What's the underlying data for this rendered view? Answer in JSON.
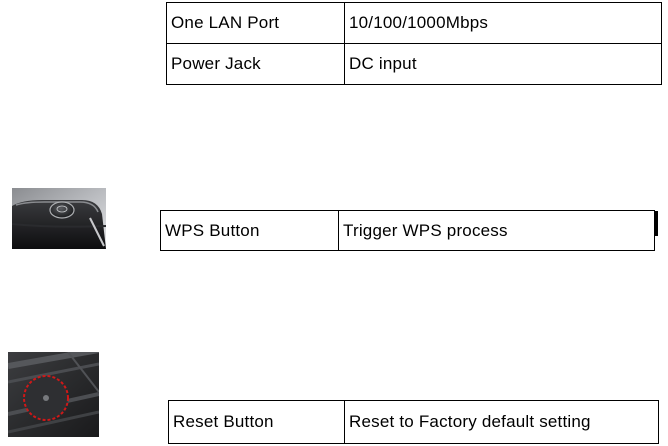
{
  "ports_table": {
    "rows": [
      {
        "name": "One LAN Port",
        "desc": "10/100/1000Mbps"
      },
      {
        "name": "Power Jack",
        "desc": "DC input"
      }
    ]
  },
  "wps_table": {
    "rows": [
      {
        "name": "WPS Button",
        "desc": "Trigger WPS process"
      }
    ]
  },
  "reset_table": {
    "rows": [
      {
        "name": "Reset Button",
        "desc": "Reset to Factory default setting"
      }
    ]
  },
  "images": {
    "wps_photo": "wps-button-photo",
    "reset_photo": "reset-button-photo",
    "reset_highlight_color": "#d01818"
  }
}
